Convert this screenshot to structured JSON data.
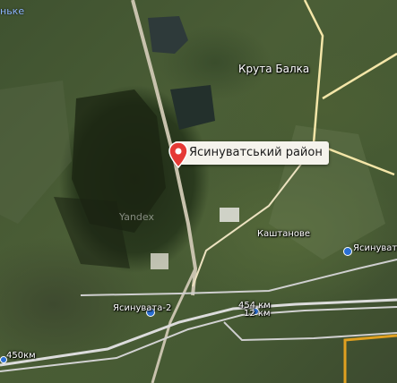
{
  "map": {
    "provider_watermark": "Yandex",
    "marker": {
      "label": "Ясинуватський район",
      "icon": "map-pin-icon",
      "color": "#e53935"
    },
    "places": {
      "top_left_edge": "ньке",
      "kruta_balka": "Крута Балка",
      "kashtanove": "Каштанове",
      "yasynuvata_2": "Ясинувата-2",
      "yasynuvata_pas": "Ясинувата-Па"
    },
    "rail_markers": {
      "km_454": "454 км",
      "km_12": "12 км",
      "km_450": "450км"
    },
    "colors": {
      "rail": "#dcdcdc",
      "road": "#f4e6a8",
      "boundary": "#e0a020"
    }
  }
}
